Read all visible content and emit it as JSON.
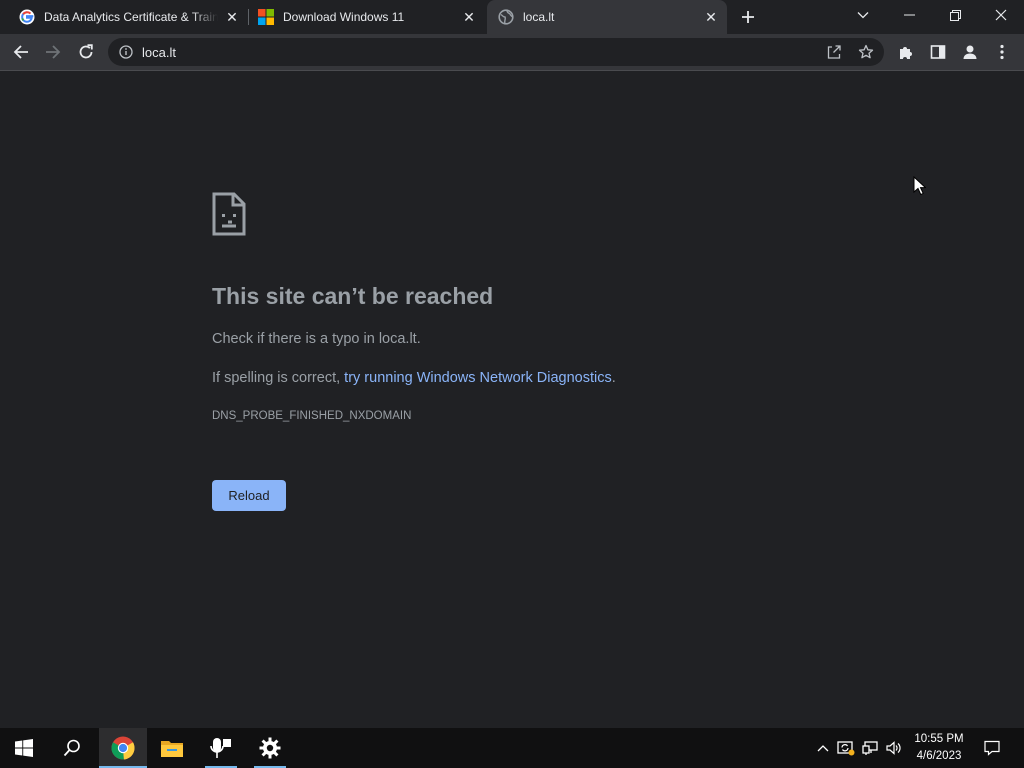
{
  "tabs": [
    {
      "title": "Data Analytics Certificate & Training",
      "icon": "google-icon"
    },
    {
      "title": "Download Windows 11",
      "icon": "microsoft-icon"
    },
    {
      "title": "loca.lt",
      "icon": "globe-icon"
    }
  ],
  "toolbar": {
    "url": "loca.lt"
  },
  "error": {
    "title": "This site can’t be reached",
    "typo_check": "Check if there is a typo in loca.lt.",
    "spelling_prefix": "If spelling is correct, ",
    "diagnostics_link": "try running Windows Network Diagnostics",
    "spelling_suffix": ".",
    "code": "DNS_PROBE_FINISHED_NXDOMAIN",
    "reload_label": "Reload"
  },
  "taskbar": {
    "pinned": [
      "start-icon",
      "search-icon",
      "chrome-icon",
      "file-explorer-icon",
      "voice-recorder-icon",
      "settings-icon"
    ],
    "clock_time": "10:55 PM",
    "clock_date": "4/6/2023"
  },
  "colors": {
    "page_bg": "#202124",
    "toolbar_bg": "#35363a",
    "link": "#8ab4f8",
    "button_bg": "#8ab4f8",
    "taskbar_bg": "#101011",
    "taskbar_active_indicator": "#76b9ed"
  }
}
